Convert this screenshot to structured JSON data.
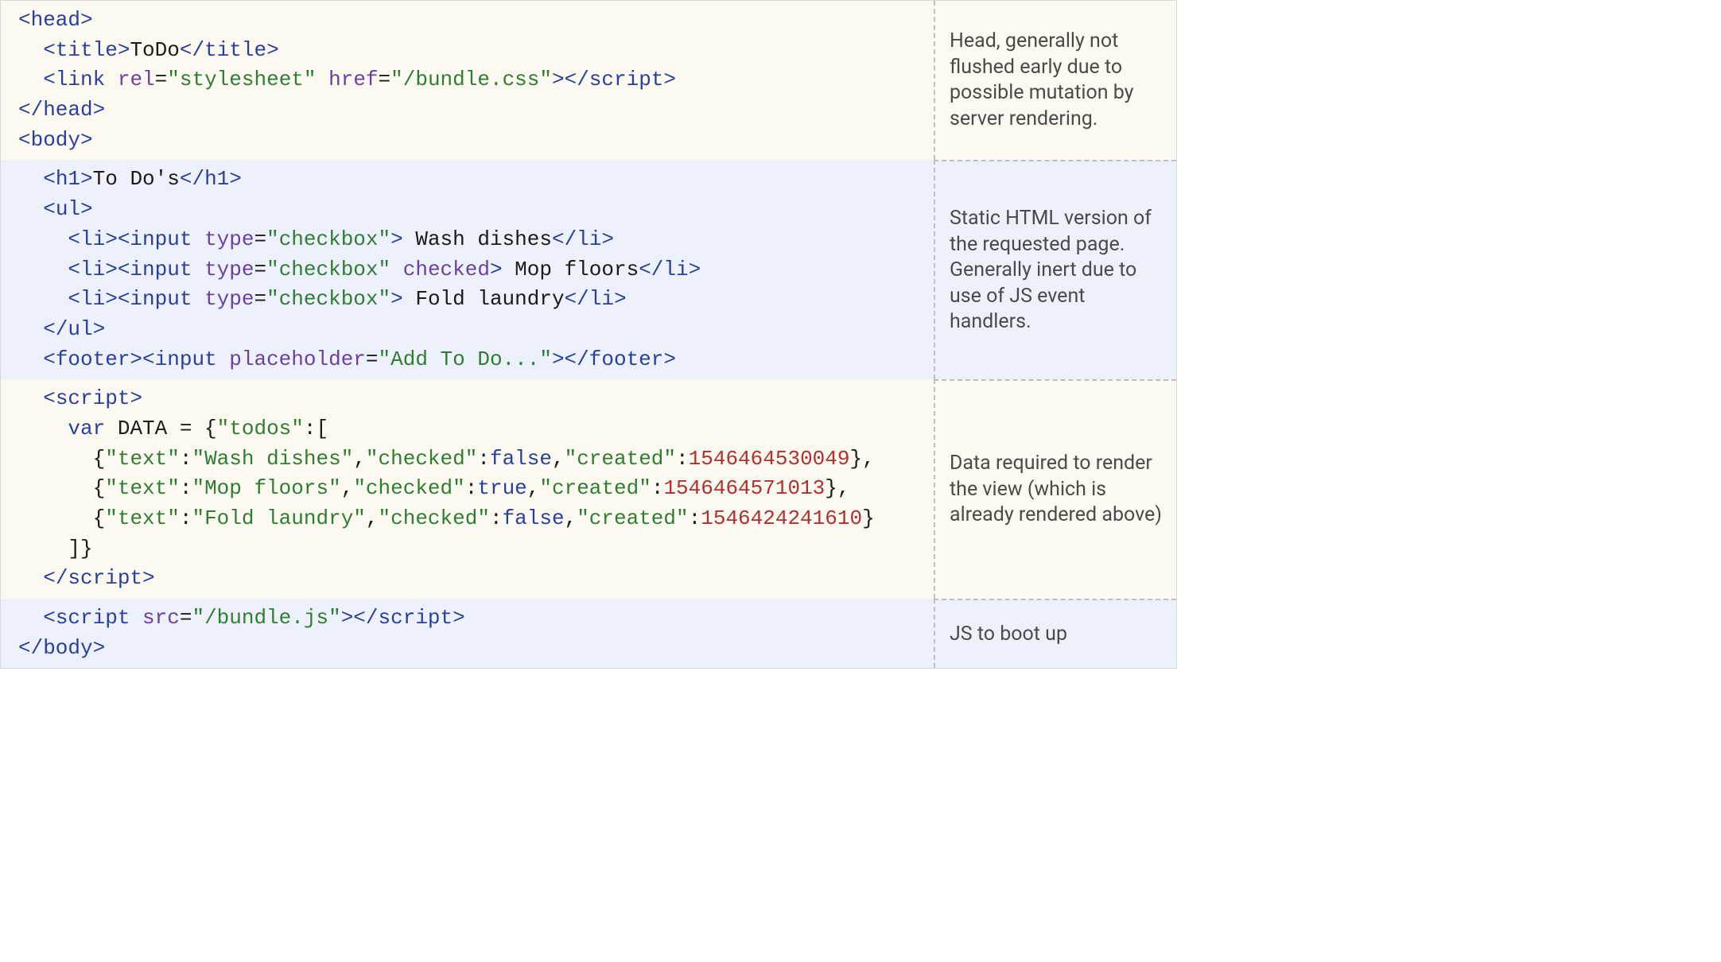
{
  "rows": [
    {
      "bg": "cream",
      "lines": [
        [
          {
            "t": "tag",
            "v": "<head>"
          }
        ],
        [
          {
            "t": "indent",
            "v": "  "
          },
          {
            "t": "tag",
            "v": "<title>"
          },
          {
            "t": "txt",
            "v": "ToDo"
          },
          {
            "t": "tag",
            "v": "</title>"
          }
        ],
        [
          {
            "t": "indent",
            "v": "  "
          },
          {
            "t": "tag",
            "v": "<link "
          },
          {
            "t": "attr",
            "v": "rel"
          },
          {
            "t": "punct",
            "v": "="
          },
          {
            "t": "str",
            "v": "\"stylesheet\""
          },
          {
            "t": "txt",
            "v": " "
          },
          {
            "t": "attr",
            "v": "href"
          },
          {
            "t": "punct",
            "v": "="
          },
          {
            "t": "str",
            "v": "\"/bundle.css\""
          },
          {
            "t": "tag",
            "v": "></script"
          },
          {
            "t": "tag",
            "v": ">"
          }
        ],
        [
          {
            "t": "tag",
            "v": "</head>"
          }
        ],
        [
          {
            "t": "tag",
            "v": "<body>"
          }
        ]
      ],
      "note": "Head, generally not flushed early due to possible mutation by server rendering."
    },
    {
      "bg": "blue",
      "lines": [
        [
          {
            "t": "indent",
            "v": "  "
          },
          {
            "t": "tag",
            "v": "<h1>"
          },
          {
            "t": "txt",
            "v": "To Do's"
          },
          {
            "t": "tag",
            "v": "</h1>"
          }
        ],
        [
          {
            "t": "indent",
            "v": "  "
          },
          {
            "t": "tag",
            "v": "<ul>"
          }
        ],
        [
          {
            "t": "indent",
            "v": "    "
          },
          {
            "t": "tag",
            "v": "<li><input "
          },
          {
            "t": "attr",
            "v": "type"
          },
          {
            "t": "punct",
            "v": "="
          },
          {
            "t": "str",
            "v": "\"checkbox\""
          },
          {
            "t": "tag",
            "v": ">"
          },
          {
            "t": "txt",
            "v": " Wash dishes"
          },
          {
            "t": "tag",
            "v": "</li>"
          }
        ],
        [
          {
            "t": "indent",
            "v": "    "
          },
          {
            "t": "tag",
            "v": "<li><input "
          },
          {
            "t": "attr",
            "v": "type"
          },
          {
            "t": "punct",
            "v": "="
          },
          {
            "t": "str",
            "v": "\"checkbox\""
          },
          {
            "t": "txt",
            "v": " "
          },
          {
            "t": "attr",
            "v": "checked"
          },
          {
            "t": "tag",
            "v": ">"
          },
          {
            "t": "txt",
            "v": " Mop floors"
          },
          {
            "t": "tag",
            "v": "</li>"
          }
        ],
        [
          {
            "t": "indent",
            "v": "    "
          },
          {
            "t": "tag",
            "v": "<li><input "
          },
          {
            "t": "attr",
            "v": "type"
          },
          {
            "t": "punct",
            "v": "="
          },
          {
            "t": "str",
            "v": "\"checkbox\""
          },
          {
            "t": "tag",
            "v": ">"
          },
          {
            "t": "txt",
            "v": " Fold laundry"
          },
          {
            "t": "tag",
            "v": "</li>"
          }
        ],
        [
          {
            "t": "indent",
            "v": "  "
          },
          {
            "t": "tag",
            "v": "</ul>"
          }
        ],
        [
          {
            "t": "indent",
            "v": "  "
          },
          {
            "t": "tag",
            "v": "<footer><input "
          },
          {
            "t": "attr",
            "v": "placeholder"
          },
          {
            "t": "punct",
            "v": "="
          },
          {
            "t": "str",
            "v": "\"Add To Do...\""
          },
          {
            "t": "tag",
            "v": "></footer>"
          }
        ]
      ],
      "note": "Static HTML version of the requested page. Generally inert due to use of JS event handlers."
    },
    {
      "bg": "cream",
      "lines": [
        [
          {
            "t": "indent",
            "v": "  "
          },
          {
            "t": "tag",
            "v": "<script"
          },
          {
            "t": "tag",
            "v": ">"
          }
        ],
        [
          {
            "t": "indent",
            "v": "    "
          },
          {
            "t": "kw",
            "v": "var"
          },
          {
            "t": "txt",
            "v": " DATA = {"
          },
          {
            "t": "str",
            "v": "\"todos\""
          },
          {
            "t": "txt",
            "v": ":["
          }
        ],
        [
          {
            "t": "indent",
            "v": "      "
          },
          {
            "t": "txt",
            "v": "{"
          },
          {
            "t": "str",
            "v": "\"text\""
          },
          {
            "t": "txt",
            "v": ":"
          },
          {
            "t": "str",
            "v": "\"Wash dishes\""
          },
          {
            "t": "txt",
            "v": ","
          },
          {
            "t": "str",
            "v": "\"checked\""
          },
          {
            "t": "txt",
            "v": ":"
          },
          {
            "t": "bool",
            "v": "false"
          },
          {
            "t": "txt",
            "v": ","
          },
          {
            "t": "str",
            "v": "\"created\""
          },
          {
            "t": "txt",
            "v": ":"
          },
          {
            "t": "num",
            "v": "1546464530049"
          },
          {
            "t": "txt",
            "v": "},"
          }
        ],
        [
          {
            "t": "indent",
            "v": "      "
          },
          {
            "t": "txt",
            "v": "{"
          },
          {
            "t": "str",
            "v": "\"text\""
          },
          {
            "t": "txt",
            "v": ":"
          },
          {
            "t": "str",
            "v": "\"Mop floors\""
          },
          {
            "t": "txt",
            "v": ","
          },
          {
            "t": "str",
            "v": "\"checked\""
          },
          {
            "t": "txt",
            "v": ":"
          },
          {
            "t": "bool",
            "v": "true"
          },
          {
            "t": "txt",
            "v": ","
          },
          {
            "t": "str",
            "v": "\"created\""
          },
          {
            "t": "txt",
            "v": ":"
          },
          {
            "t": "num",
            "v": "1546464571013"
          },
          {
            "t": "txt",
            "v": "},"
          }
        ],
        [
          {
            "t": "indent",
            "v": "      "
          },
          {
            "t": "txt",
            "v": "{"
          },
          {
            "t": "str",
            "v": "\"text\""
          },
          {
            "t": "txt",
            "v": ":"
          },
          {
            "t": "str",
            "v": "\"Fold laundry\""
          },
          {
            "t": "txt",
            "v": ","
          },
          {
            "t": "str",
            "v": "\"checked\""
          },
          {
            "t": "txt",
            "v": ":"
          },
          {
            "t": "bool",
            "v": "false"
          },
          {
            "t": "txt",
            "v": ","
          },
          {
            "t": "str",
            "v": "\"created\""
          },
          {
            "t": "txt",
            "v": ":"
          },
          {
            "t": "num",
            "v": "1546424241610"
          },
          {
            "t": "txt",
            "v": "}"
          }
        ],
        [
          {
            "t": "indent",
            "v": "    "
          },
          {
            "t": "txt",
            "v": "]}"
          }
        ],
        [
          {
            "t": "indent",
            "v": "  "
          },
          {
            "t": "tag",
            "v": "</script"
          },
          {
            "t": "tag",
            "v": ">"
          }
        ]
      ],
      "note": "Data required to render the view (which is already rendered above)"
    },
    {
      "bg": "blue",
      "lines": [
        [
          {
            "t": "indent",
            "v": "  "
          },
          {
            "t": "tag",
            "v": "<script "
          },
          {
            "t": "attr",
            "v": "src"
          },
          {
            "t": "punct",
            "v": "="
          },
          {
            "t": "str",
            "v": "\"/bundle.js\""
          },
          {
            "t": "tag",
            "v": "></script"
          },
          {
            "t": "tag",
            "v": ">"
          }
        ],
        [
          {
            "t": "tag",
            "v": "</body>"
          }
        ]
      ],
      "note": "JS to boot up"
    }
  ]
}
